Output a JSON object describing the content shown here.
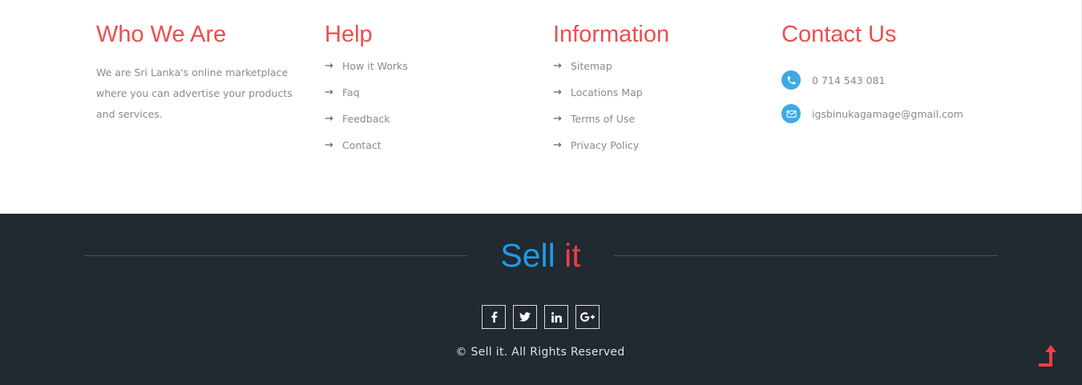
{
  "footer": {
    "who": {
      "title": "Who We Are",
      "text": "We are Sri Lanka's online marketplace where you can advertise your products and services."
    },
    "help": {
      "title": "Help",
      "links": [
        "How it Works",
        "Faq",
        "Feedback",
        "Contact"
      ]
    },
    "info": {
      "title": "Information",
      "links": [
        "Sitemap",
        "Locations Map",
        "Terms of Use",
        "Privacy Policy"
      ]
    },
    "contact": {
      "title": "Contact Us",
      "phone": "0 714 543 081",
      "email": "igsbinukagamage@gmail.com",
      "phone_icon": "phone-icon",
      "email_icon": "envelope-icon"
    },
    "arrow_glyph": "→"
  },
  "bottom": {
    "brand_part1": "Sell",
    "brand_part2": "it",
    "social": [
      {
        "icon": "facebook-icon",
        "glyph": "f"
      },
      {
        "icon": "twitter-icon",
        "glyph": "t"
      },
      {
        "icon": "linkedin-icon",
        "glyph": "in"
      },
      {
        "icon": "google-plus-icon",
        "glyph": "G+"
      }
    ],
    "copyright": "© Sell it. All Rights Reserved",
    "back_to_top_icon": "back-to-top-arrow-icon"
  },
  "colors": {
    "heading": "#ee4d4d",
    "brand_blue": "#1f9be6",
    "brand_red": "#ee4040",
    "footer_bg": "#212931",
    "icon_circle": "#3fa9e4"
  }
}
